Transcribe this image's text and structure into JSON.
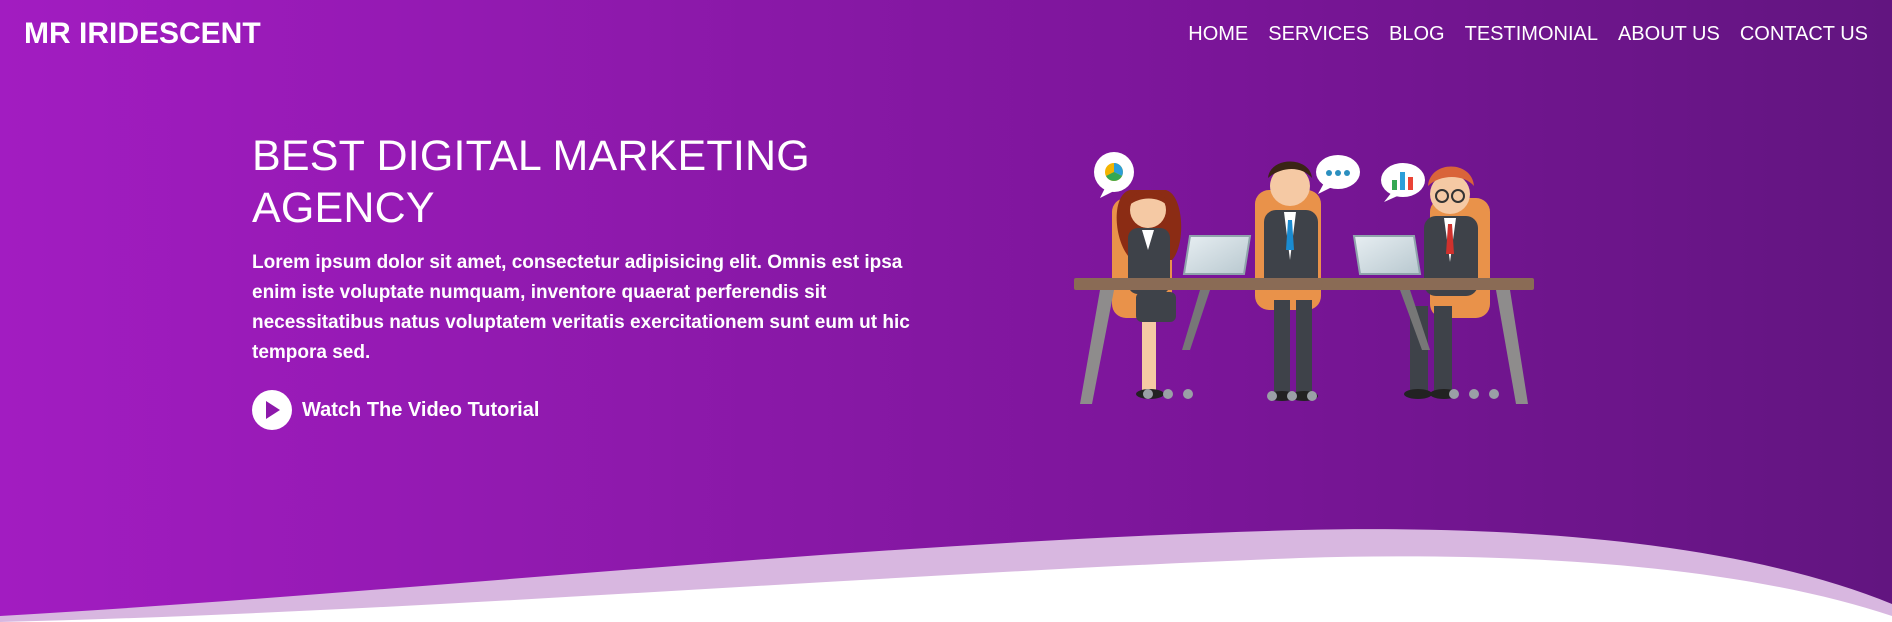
{
  "brand": {
    "name": "MR IRIDESCENT"
  },
  "nav": {
    "items": [
      {
        "label": "HOME"
      },
      {
        "label": "SERVICES"
      },
      {
        "label": "BLOG"
      },
      {
        "label": "TESTIMONIAL"
      },
      {
        "label": "ABOUT US"
      },
      {
        "label": "CONTACT US"
      }
    ]
  },
  "hero": {
    "title": "BEST DIGITAL MARKETING AGENCY",
    "description": "Lorem ipsum dolor sit amet, consectetur adipisicing elit. Omnis est ipsa enim iste voluptate numquam, inventore quaerat perferendis sit necessitatibus natus voluptatem veritatis exercitationem sunt eum ut hic tempora sed.",
    "cta_label": "Watch The Video Tutorial",
    "cta_icon": "play-icon"
  },
  "illustration": {
    "icon": "business-meeting-illustration"
  },
  "colors": {
    "gradient_start": "#a21cc1",
    "gradient_end": "#621580",
    "wave_light": "#d8b7e0",
    "wave_white": "#ffffff",
    "accent": "#8d19ab"
  }
}
